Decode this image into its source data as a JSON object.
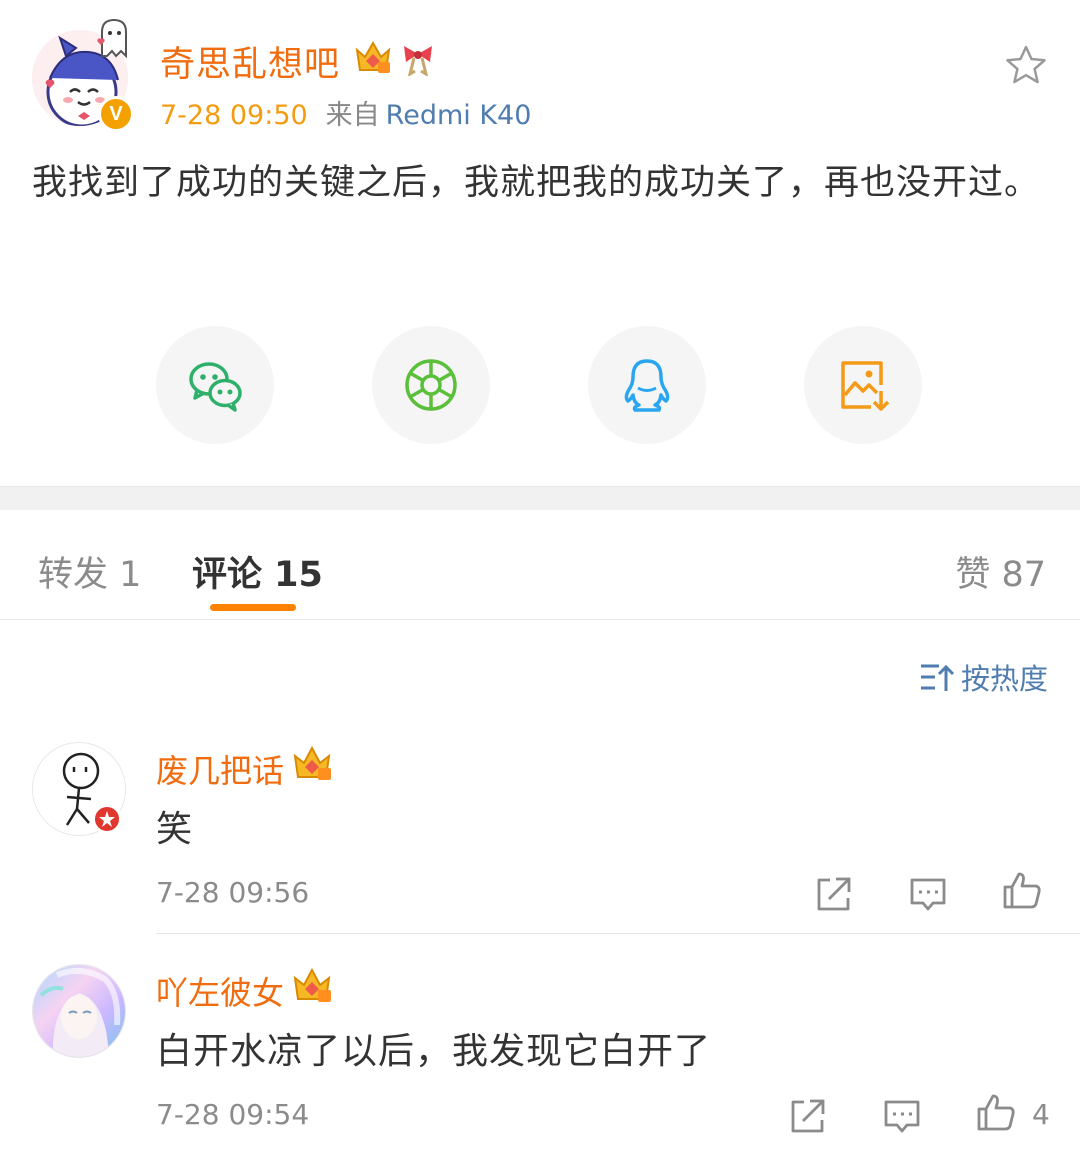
{
  "post": {
    "author": "奇思乱想吧",
    "time": "7-28 09:50",
    "from_label": "来自",
    "device": "Redmi K40",
    "verified_badge": "V",
    "text": "我找到了成功的关键之后，我就把我的成功关了，再也没开过。"
  },
  "share": {
    "items": [
      "wechat-icon",
      "moments-icon",
      "qq-icon",
      "save-image-icon"
    ]
  },
  "tabs": {
    "repost": "转发 1",
    "comments": "评论 15",
    "likes": "赞 87"
  },
  "sort": {
    "label": "按热度"
  },
  "comments": [
    {
      "name": "废几把话",
      "text": "笑",
      "time": "7-28 09:56",
      "likes": ""
    },
    {
      "name": "吖左彼女",
      "text": "白开水凉了以后，我发现它白开了",
      "time": "7-28 09:54",
      "likes": "4"
    }
  ],
  "colors": {
    "username": "#f06c0f",
    "time": "#f39c12",
    "link": "#507daf",
    "tab_underline": "#ff8200"
  }
}
